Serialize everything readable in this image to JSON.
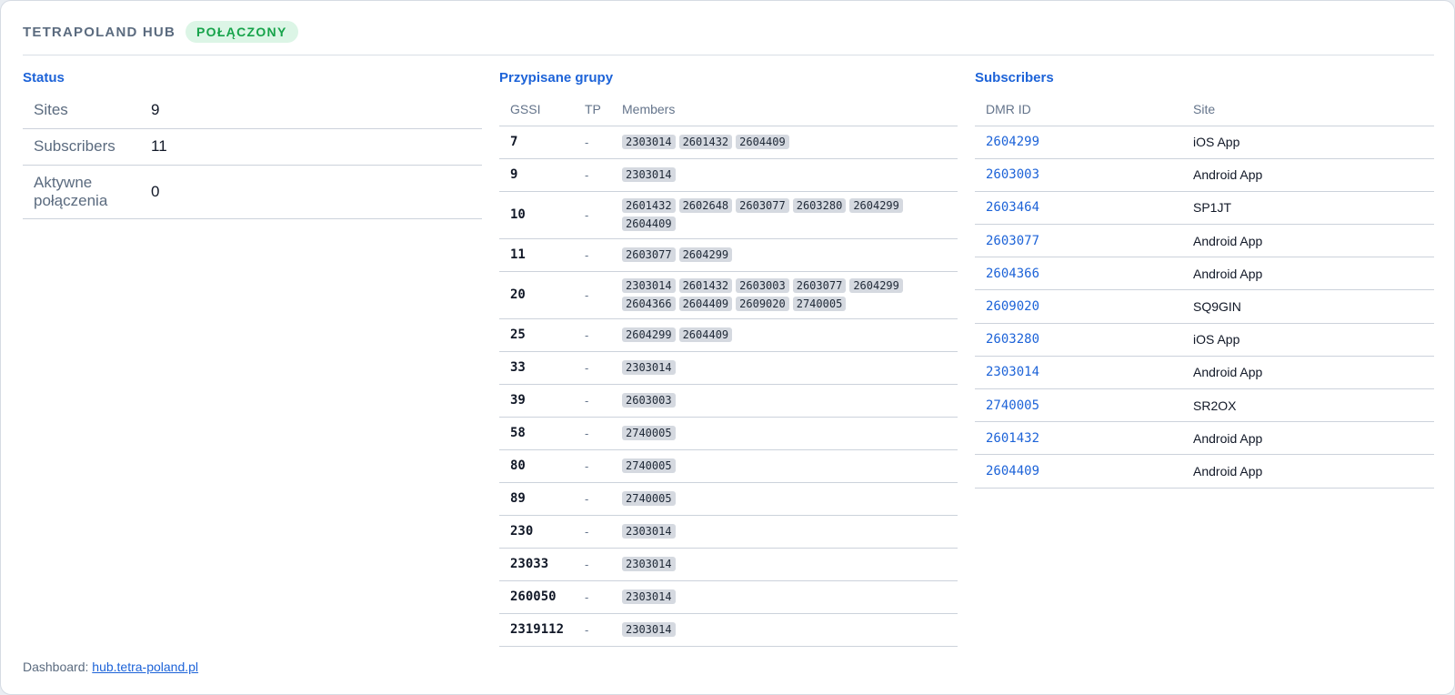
{
  "header": {
    "title": "TETRAPOLAND HUB",
    "status_badge": "POŁĄCZONY"
  },
  "status": {
    "title": "Status",
    "rows": [
      {
        "label": "Sites",
        "value": "9"
      },
      {
        "label": "Subscribers",
        "value": "11"
      },
      {
        "label": "Aktywne połączenia",
        "value": "0"
      }
    ]
  },
  "groups": {
    "title": "Przypisane grupy",
    "columns": [
      "GSSI",
      "TP",
      "Members"
    ],
    "rows": [
      {
        "gssi": "7",
        "tp": "-",
        "members": [
          "2303014",
          "2601432",
          "2604409"
        ]
      },
      {
        "gssi": "9",
        "tp": "-",
        "members": [
          "2303014"
        ]
      },
      {
        "gssi": "10",
        "tp": "-",
        "members": [
          "2601432",
          "2602648",
          "2603077",
          "2603280",
          "2604299",
          "2604409"
        ]
      },
      {
        "gssi": "11",
        "tp": "-",
        "members": [
          "2603077",
          "2604299"
        ]
      },
      {
        "gssi": "20",
        "tp": "-",
        "members": [
          "2303014",
          "2601432",
          "2603003",
          "2603077",
          "2604299",
          "2604366",
          "2604409",
          "2609020",
          "2740005"
        ]
      },
      {
        "gssi": "25",
        "tp": "-",
        "members": [
          "2604299",
          "2604409"
        ]
      },
      {
        "gssi": "33",
        "tp": "-",
        "members": [
          "2303014"
        ]
      },
      {
        "gssi": "39",
        "tp": "-",
        "members": [
          "2603003"
        ]
      },
      {
        "gssi": "58",
        "tp": "-",
        "members": [
          "2740005"
        ]
      },
      {
        "gssi": "80",
        "tp": "-",
        "members": [
          "2740005"
        ]
      },
      {
        "gssi": "89",
        "tp": "-",
        "members": [
          "2740005"
        ]
      },
      {
        "gssi": "230",
        "tp": "-",
        "members": [
          "2303014"
        ]
      },
      {
        "gssi": "23033",
        "tp": "-",
        "members": [
          "2303014"
        ]
      },
      {
        "gssi": "260050",
        "tp": "-",
        "members": [
          "2303014"
        ]
      },
      {
        "gssi": "2319112",
        "tp": "-",
        "members": [
          "2303014"
        ]
      }
    ]
  },
  "subscribers": {
    "title": "Subscribers",
    "columns": [
      "DMR ID",
      "Site"
    ],
    "rows": [
      {
        "id": "2604299",
        "site": "iOS App"
      },
      {
        "id": "2603003",
        "site": "Android App"
      },
      {
        "id": "2603464",
        "site": "SP1JT"
      },
      {
        "id": "2603077",
        "site": "Android App"
      },
      {
        "id": "2604366",
        "site": "Android App"
      },
      {
        "id": "2609020",
        "site": "SQ9GIN"
      },
      {
        "id": "2603280",
        "site": "iOS App"
      },
      {
        "id": "2303014",
        "site": "Android App"
      },
      {
        "id": "2740005",
        "site": "SR2OX"
      },
      {
        "id": "2601432",
        "site": "Android App"
      },
      {
        "id": "2604409",
        "site": "Android App"
      }
    ]
  },
  "footer": {
    "label": "Dashboard:",
    "link_text": "hub.tetra-poland.pl"
  }
}
